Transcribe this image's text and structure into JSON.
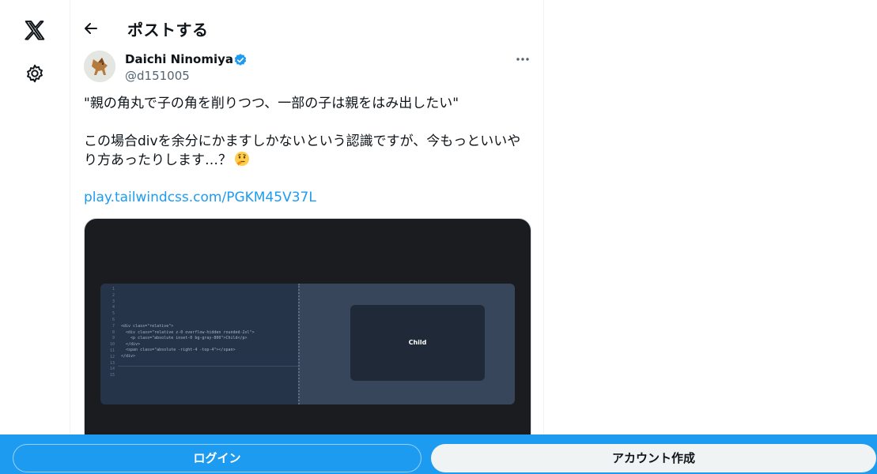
{
  "nav": {
    "logo_icon": "x-logo-icon",
    "settings_icon": "gear-icon"
  },
  "header": {
    "back_icon": "arrow-left-icon",
    "title": "ポストする"
  },
  "author": {
    "display_name": "Daichi Ninomiya",
    "handle": "@d151005",
    "verified_icon": "verified-badge-icon",
    "more_icon": "more-horizontal-icon"
  },
  "tweet": {
    "line1": "\"親の角丸で子の角を削りつつ、一部の子は親をはみ出したい\"",
    "line2": "この場合divを余分にかますしかないという認識ですが、今もっといいや",
    "line3": "り方あったりします…？",
    "emoji": "thinking-face-icon",
    "link": "play.tailwindcss.com/PGKM45V37L"
  },
  "media": {
    "line_numbers": [
      "1",
      "2",
      "3",
      "4",
      "5",
      "6",
      "7",
      "8",
      "9",
      "10",
      "11",
      "12",
      "13",
      "14",
      "15"
    ],
    "code_lines": [
      "<div class=\"relative\">",
      "  <div class=\"relative z-0 overflow-hidden rounded-2xl\">",
      "    <p class=\"absolute inset-0 bg-gray-800\">Child</p>",
      "  </div>",
      "  <span class=\"absolute -right-4 -top-4\"></span>",
      "</div>"
    ],
    "preview_label": "Child"
  },
  "bottombar": {
    "login": "ログイン",
    "signup": "アカウント作成"
  },
  "colors": {
    "accent": "#1d9bf0",
    "text": "#0f1419",
    "muted": "#536471"
  }
}
